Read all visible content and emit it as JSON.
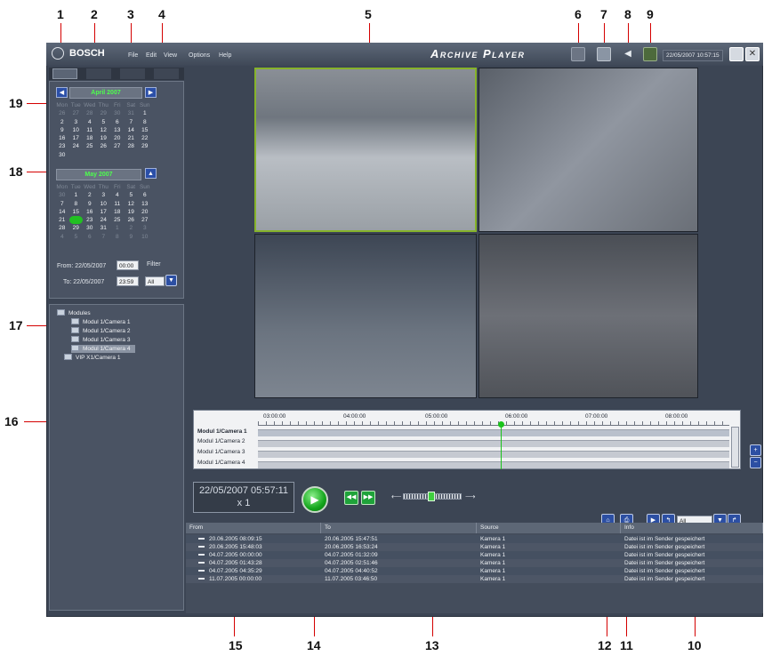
{
  "callouts": [
    "1",
    "2",
    "3",
    "4",
    "5",
    "6",
    "7",
    "8",
    "9",
    "10",
    "11",
    "12",
    "13",
    "14",
    "15",
    "16",
    "17",
    "18",
    "19"
  ],
  "app": {
    "brand": "BOSCH",
    "menu": [
      "File",
      "Edit",
      "View",
      "Options",
      "Help"
    ],
    "title": "Archive Player",
    "datetime": "22/05/2007 10:57:15"
  },
  "calendar": {
    "month1": "April 2007",
    "month2": "May 2007",
    "weekdays": [
      "Mon",
      "Tue",
      "Wed",
      "Thu",
      "Fri",
      "Sat",
      "Sun"
    ],
    "april_days": [
      "26",
      "27",
      "28",
      "29",
      "30",
      "31",
      "1",
      "2",
      "3",
      "4",
      "5",
      "6",
      "7",
      "8",
      "9",
      "10",
      "11",
      "12",
      "13",
      "14",
      "15",
      "16",
      "17",
      "18",
      "19",
      "20",
      "21",
      "22",
      "23",
      "24",
      "25",
      "26",
      "27",
      "28",
      "29",
      "30"
    ],
    "may_days": [
      "30",
      "1",
      "2",
      "3",
      "4",
      "5",
      "6",
      "7",
      "8",
      "9",
      "10",
      "11",
      "12",
      "13",
      "14",
      "15",
      "16",
      "17",
      "18",
      "19",
      "20",
      "21",
      "22",
      "23",
      "24",
      "25",
      "26",
      "27",
      "28",
      "29",
      "30",
      "31",
      "1",
      "2",
      "3",
      "4",
      "5",
      "6",
      "7",
      "8",
      "9",
      "10"
    ],
    "from_label": "From: 22/05/2007",
    "from_time": "00:00",
    "to_label": "To: 22/05/2007",
    "to_time": "23:59",
    "filter_label": "Filter",
    "filter_value": "All"
  },
  "tree": {
    "root": "Modules",
    "items": [
      "Modul 1/Camera 1",
      "Modul 1/Camera 2",
      "Modul 1/Camera 3",
      "Modul 1/Camera 4",
      "VIP X1/Camera 1"
    ]
  },
  "timeline": {
    "hours": [
      "03:00:00",
      "04:00:00",
      "05:00:00",
      "06:00:00",
      "07:00:00",
      "08:00:00"
    ],
    "rows": [
      "Modul 1/Camera 1",
      "Modul 1/Camera 2",
      "Modul 1/Camera 3",
      "Modul 1/Camera 4"
    ]
  },
  "playback": {
    "datetime": "22/05/2007 05:57:11",
    "speed": "x 1",
    "filter": "All"
  },
  "table": {
    "headers": [
      "From",
      "To",
      "Source",
      "Info"
    ],
    "rows": [
      [
        "20.06.2005 08:09:15",
        "20.06.2005 15:47:51",
        "Kamera 1",
        "Datei ist im Sender gespeichert"
      ],
      [
        "20.06.2005 15:48:03",
        "20.06.2005 16:53:24",
        "Kamera 1",
        "Datei ist im Sender gespeichert"
      ],
      [
        "04.07.2005 00:00:00",
        "04.07.2005 01:32:09",
        "Kamera 1",
        "Datei ist im Sender gespeichert"
      ],
      [
        "04.07.2005 01:43:28",
        "04.07.2005 02:51:46",
        "Kamera 1",
        "Datei ist im Sender gespeichert"
      ],
      [
        "04.07.2005 04:35:29",
        "04.07.2005 04:40:52",
        "Kamera 1",
        "Datei ist im Sender gespeichert"
      ],
      [
        "11.07.2005 00:00:00",
        "11.07.2005 03:46:50",
        "Kamera 1",
        "Datei ist im Sender gespeichert"
      ]
    ]
  }
}
